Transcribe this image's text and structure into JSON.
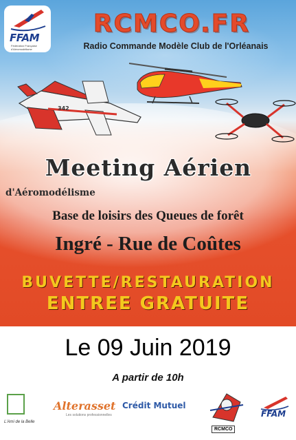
{
  "header": {
    "federation_logo": {
      "label": "FFAM",
      "caption": "Fédération Française d'Aéromodélisme"
    },
    "club_name": "RCMCO.FR",
    "club_subtitle": "Radio Commande Modèle Club de l'Orléanais"
  },
  "event": {
    "title": "Meeting Aérien",
    "subtitle": "d'Aéromodélisme",
    "venue": "Base de loisirs des Queues de forêt",
    "location": "Ingré - Rue de Coûtes",
    "services": "BUVETTE/RESTAURATION",
    "entry": "ENTREE GRATUITE"
  },
  "schedule": {
    "date": "Le 09 Juin 2019",
    "start_time": "A partir de 10h"
  },
  "sponsors": [
    {
      "name": "L'Ami de la Belle",
      "icon": "sponsor-green-square-logo"
    },
    {
      "name": "Alterasset",
      "tagline": "Les solutions professionnelles"
    },
    {
      "name": "Crédit Mutuel",
      "icon": "credit-mutuel-logo"
    },
    {
      "name": "RCMCO",
      "icon": "rcmco-mascot-logo"
    },
    {
      "name": "FFAM",
      "icon": "ffam-logo"
    }
  ],
  "colors": {
    "accent_red": "#e34b2b",
    "title_yellow": "#f4c81e",
    "sky_blue": "#5ba5dc",
    "ffam_blue": "#1c3d8f"
  }
}
